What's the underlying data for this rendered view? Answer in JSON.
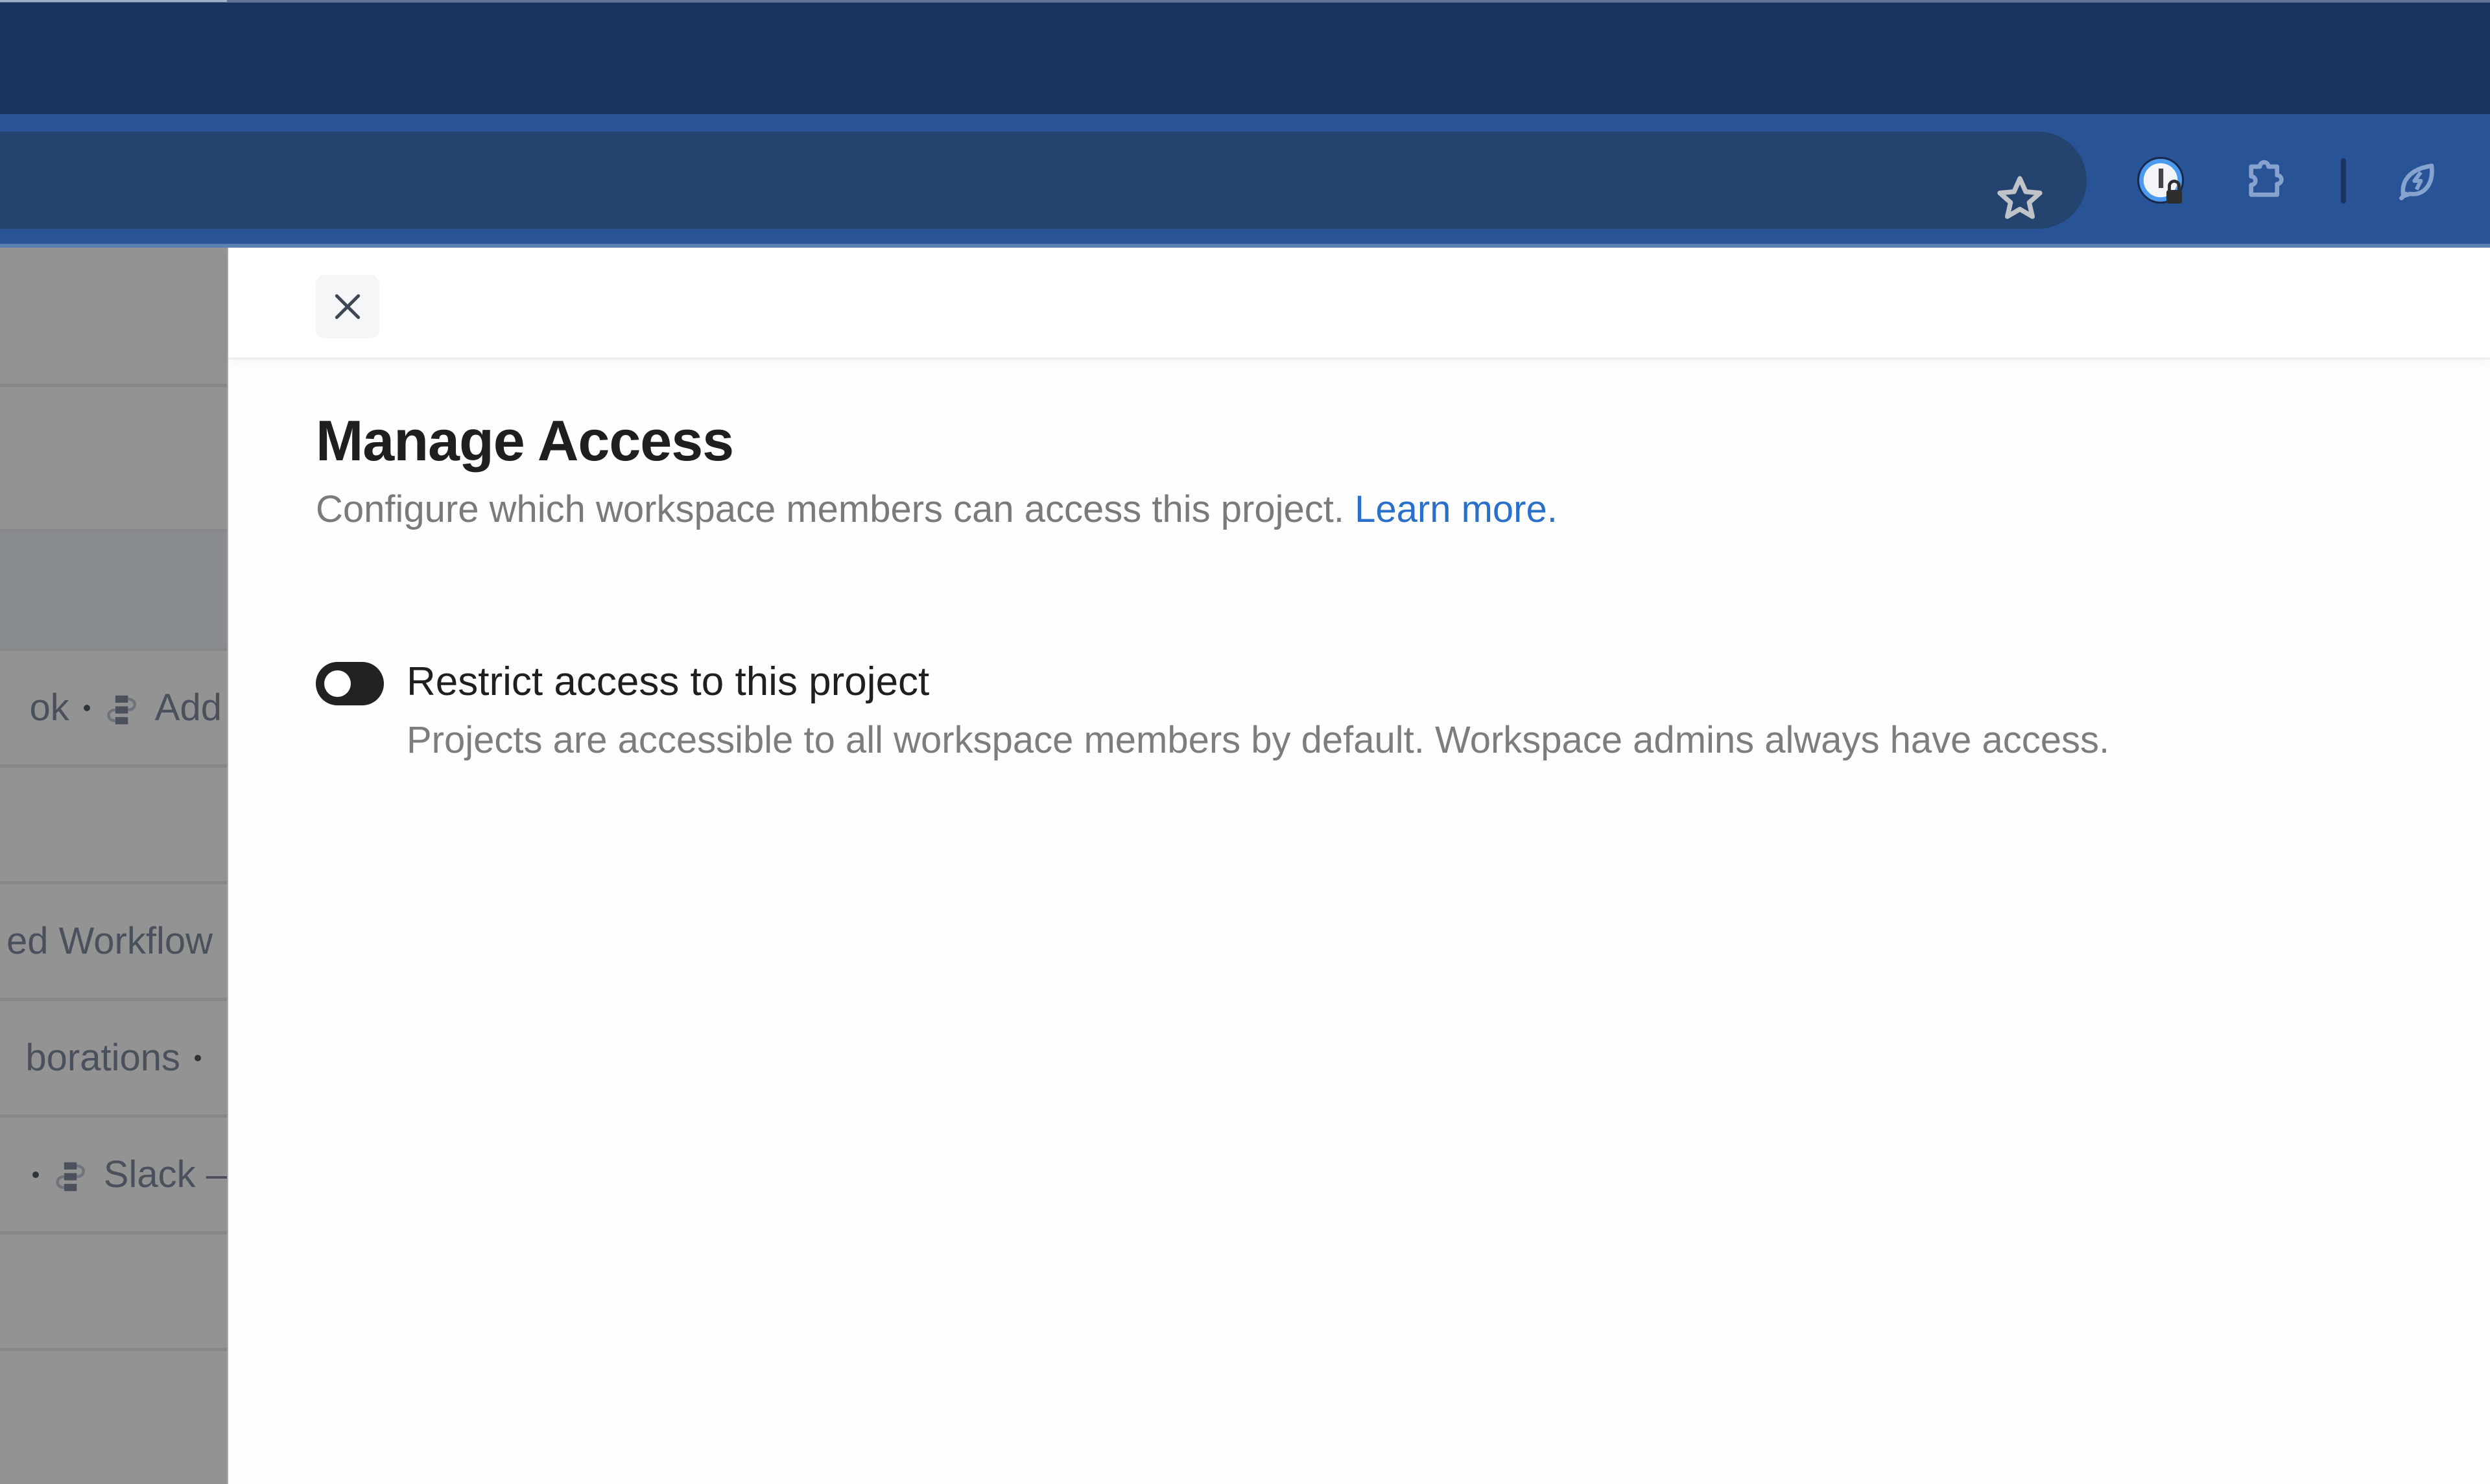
{
  "browser": {
    "toolbar_icons": [
      {
        "name": "bookmark-star-icon"
      },
      {
        "name": "password-manager-icon"
      },
      {
        "name": "extensions-icon"
      },
      {
        "name": "energy-saver-icon"
      }
    ],
    "colors": {
      "tab_bar": "#1a3461",
      "toolbar": "#285497",
      "omnibox": "#24446f"
    }
  },
  "background_list": {
    "rows": [
      {
        "text": ""
      },
      {
        "text": ""
      },
      {
        "text": "",
        "highlighted": true
      },
      {
        "prefix": "ok",
        "integration": "Add"
      },
      {
        "text": ""
      },
      {
        "text": "ed Workflow"
      },
      {
        "text": "borations"
      },
      {
        "integration": "Slack –"
      },
      {
        "text": ""
      }
    ]
  },
  "drawer": {
    "close_label": "Close",
    "title": "Manage Access",
    "subtitle": "Configure which workspace members can access this project.",
    "learn_more": "Learn more.",
    "setting": {
      "label": "Restrict access to this project",
      "description": "Projects are accessible to all workspace members by default. Workspace admins always have access.",
      "enabled": false
    },
    "colors": {
      "link": "#2a70c8",
      "toggle": "#222222"
    }
  }
}
